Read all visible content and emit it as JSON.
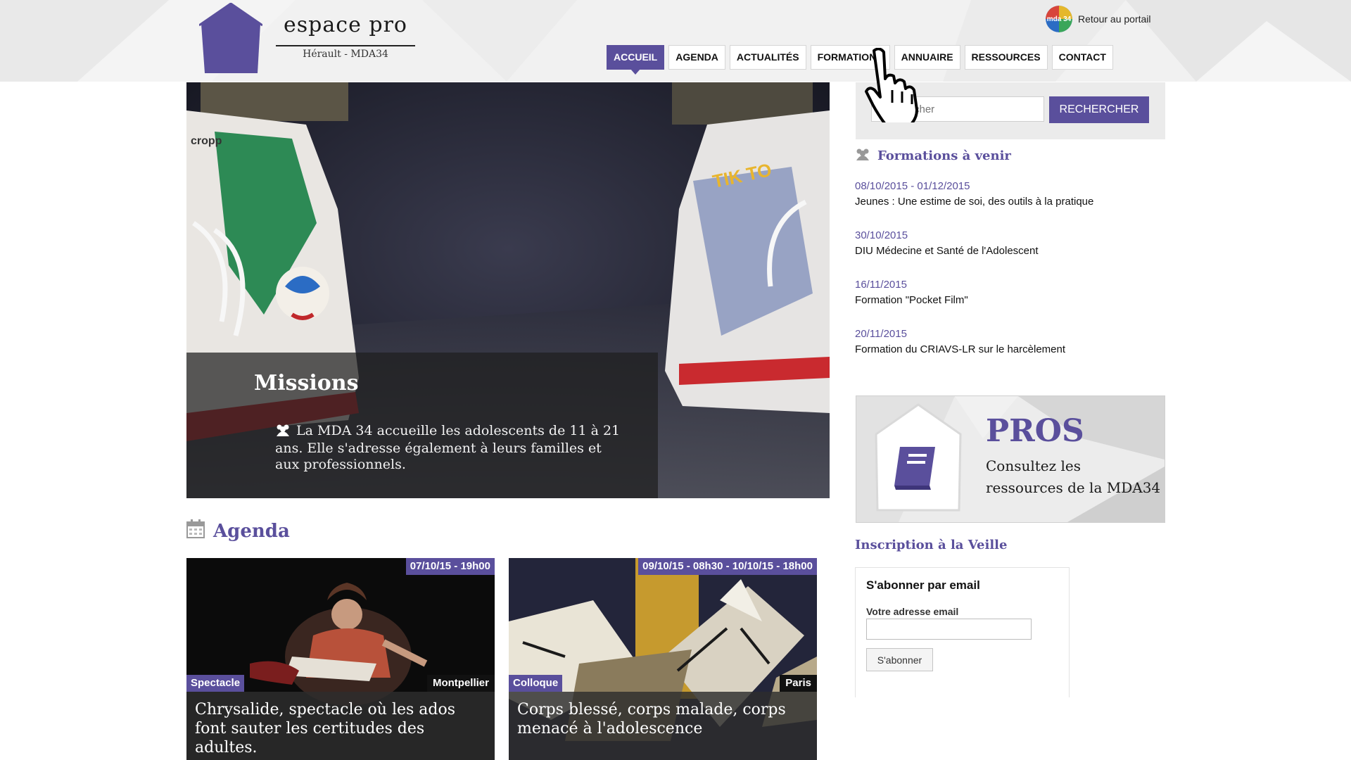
{
  "header": {
    "site_title": "espace pro",
    "site_subtitle": "Hérault - MDA34",
    "portal_link": "Retour au portail",
    "portal_badge_text": "mda 34"
  },
  "nav": {
    "items": [
      {
        "label": "ACCUEIL",
        "active": true
      },
      {
        "label": "AGENDA"
      },
      {
        "label": "ACTUALITÉS"
      },
      {
        "label": "FORMATIONS"
      },
      {
        "label": "ANNUAIRE"
      },
      {
        "label": "RESSOURCES"
      },
      {
        "label": "CONTACT"
      }
    ]
  },
  "hero": {
    "title": "Missions",
    "text": "La MDA 34 accueille les adolescents de 11 à 21 ans. Elle s'adresse également à leurs familles et aux professionnels.",
    "shoe_left_brand": "cropp",
    "shoe_right_text": "TIK TO"
  },
  "agenda": {
    "title": "Agenda",
    "events": [
      {
        "date": "07/10/15 - 19h00",
        "category": "Spectacle",
        "city": "Montpellier",
        "title": "Chrysalide, spectacle où les ados font sauter les certitudes des adultes."
      },
      {
        "date": "09/10/15 - 08h30 - 10/10/15 - 18h00",
        "category": "Colloque",
        "city": "Paris",
        "title": "Corps blessé, corps malade, corps menacé à l'adolescence"
      }
    ]
  },
  "search": {
    "placeholder": "Rechercher",
    "visible_placeholder": "cher",
    "button": "RECHERCHER"
  },
  "trainings": {
    "title": "Formations à venir",
    "items": [
      {
        "date": "08/10/2015 - 01/12/2015",
        "title": "Jeunes : Une estime de soi, des outils à la pratique"
      },
      {
        "date": "30/10/2015",
        "title": "DIU Médecine et Santé de l'Adolescent"
      },
      {
        "date": "16/11/2015",
        "title": "Formation \"Pocket Film\""
      },
      {
        "date": "20/11/2015",
        "title": "Formation du CRIAVS-LR sur le harcèlement"
      }
    ]
  },
  "pros": {
    "title": "PROS",
    "text": "Consultez les ressources de la MDA34"
  },
  "newsletter": {
    "heading": "Inscription à la Veille",
    "title": "S'abonner par email",
    "label": "Votre adresse email",
    "value": "",
    "button": "S'abonner"
  },
  "colors": {
    "accent": "#5a4f9c",
    "header_bg": "#f1f1f1"
  },
  "icons": [
    "house-logo-icon",
    "portal-logo-icon",
    "users-icon",
    "calendar-icon",
    "book-icon",
    "hand-cursor-icon"
  ]
}
